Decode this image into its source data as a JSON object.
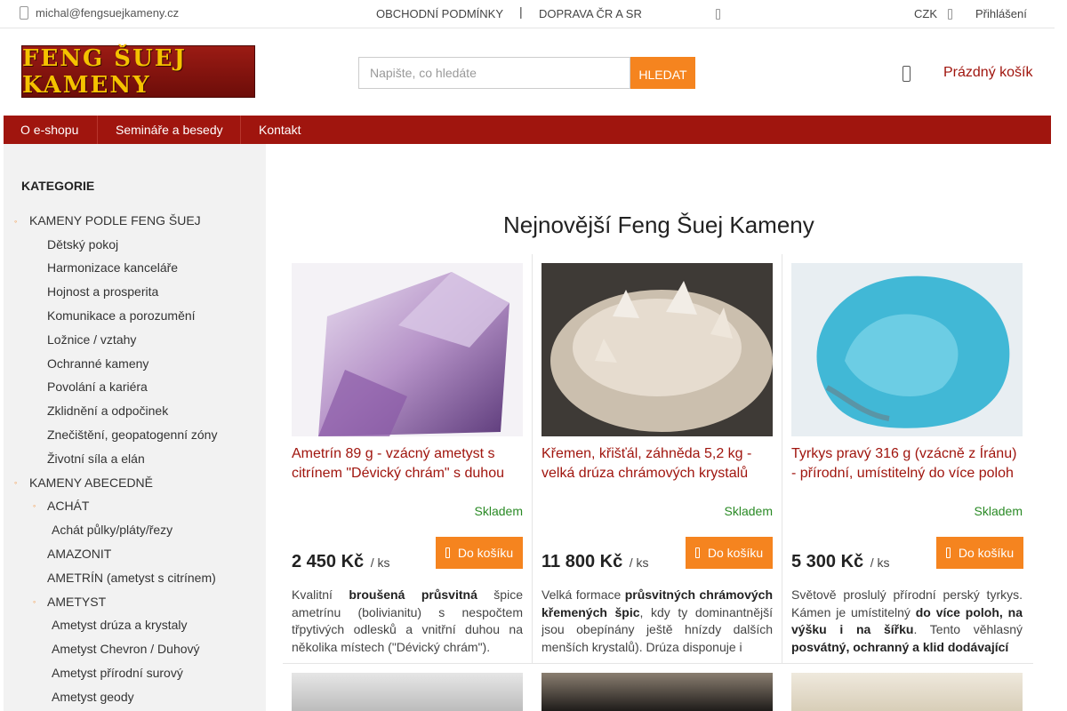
{
  "topbar": {
    "email": "michal@fengsuejkameny.cz",
    "link_terms": "OBCHODNÍ PODMÍNKY",
    "separator": "|",
    "link_shipping": "DOPRAVA ČR A SR",
    "currency": "CZK",
    "login": "Přihlášení"
  },
  "header": {
    "logo_text": "FENG ŠUEJ KAMENY",
    "search_placeholder": "Napište, co hledáte",
    "search_button": "HLEDAT",
    "cart_label": "Prázdný košík"
  },
  "nav": {
    "items": [
      "O e-shopu",
      "Semináře a besedy",
      "Kontakt"
    ]
  },
  "sidebar": {
    "title": "KATEGORIE",
    "items": [
      {
        "label": "KAMENY PODLE FENG ŠUEJ",
        "bullet": true
      },
      {
        "label": "Dětský pokoj"
      },
      {
        "label": "Harmonizace kanceláře"
      },
      {
        "label": "Hojnost a prosperita"
      },
      {
        "label": "Komunikace a porozumění"
      },
      {
        "label": "Ložnice / vztahy"
      },
      {
        "label": "Ochranné kameny"
      },
      {
        "label": "Povolání a kariéra"
      },
      {
        "label": "Zklidnění a odpočinek"
      },
      {
        "label": "Znečištění, geopatogenní zóny"
      },
      {
        "label": "Životní síla a elán"
      },
      {
        "label": "KAMENY ABECEDNĚ",
        "bullet": true
      },
      {
        "label": "ACHÁT",
        "bullet": true
      },
      {
        "label": "Achát půlky/pláty/řezy"
      },
      {
        "label": "AMAZONIT"
      },
      {
        "label": "AMETRÍN (ametyst s citrínem)"
      },
      {
        "label": "AMETYST",
        "bullet": true
      },
      {
        "label": "Ametyst drúza a krystaly"
      },
      {
        "label": "Ametyst Chevron / Duhový"
      },
      {
        "label": "Ametyst přírodní surový"
      },
      {
        "label": "Ametyst geody"
      }
    ]
  },
  "main": {
    "title": "Nejnovější Feng Šuej Kameny",
    "products": [
      {
        "name": "Ametrín 89 g - vzácný ametyst s citrínem \"Dévický chrám\" s duhou",
        "stock": "Skladem",
        "price": "2 450 Kč",
        "unit": "/ ks",
        "buy": "Do košíku",
        "desc_parts": [
          "Kvalitní ",
          "broušená průsvitná",
          " špice ametrínu (bolivianitu) s nespočtem třpytivých odlesků a vnitřní duhou na několika místech (\"Dévický chrám\")."
        ]
      },
      {
        "name": "Křemen, křišťál, záhněda 5,2 kg - velká drúza chrámových krystalů",
        "stock": "Skladem",
        "price": "11 800 Kč",
        "unit": "/ ks",
        "buy": "Do košíku",
        "desc_parts": [
          "Velká formace ",
          "průsvitných chrámových křemených špic",
          ", kdy ty dominantnější jsou obepínány ještě hnízdy dalších menších krystalů). Drúza disponuje i"
        ]
      },
      {
        "name": "Tyrkys pravý 316 g (vzácně z Íránu) - přírodní, umístitelný do více poloh",
        "stock": "Skladem",
        "price": "5 300 Kč",
        "unit": "/ ks",
        "buy": "Do košíku",
        "desc_parts": [
          "Světově proslulý přírodní perský tyrkys. Kámen je umístitelný ",
          "do více poloh, na výšku i na šířku",
          ". Tento věhlasný ",
          "posvátný, ochranný a klid dodávající",
          ""
        ]
      }
    ]
  },
  "colors": {
    "brand_red": "#a0150e",
    "accent_orange": "#f5841f",
    "stock_green": "#2a8a25"
  }
}
